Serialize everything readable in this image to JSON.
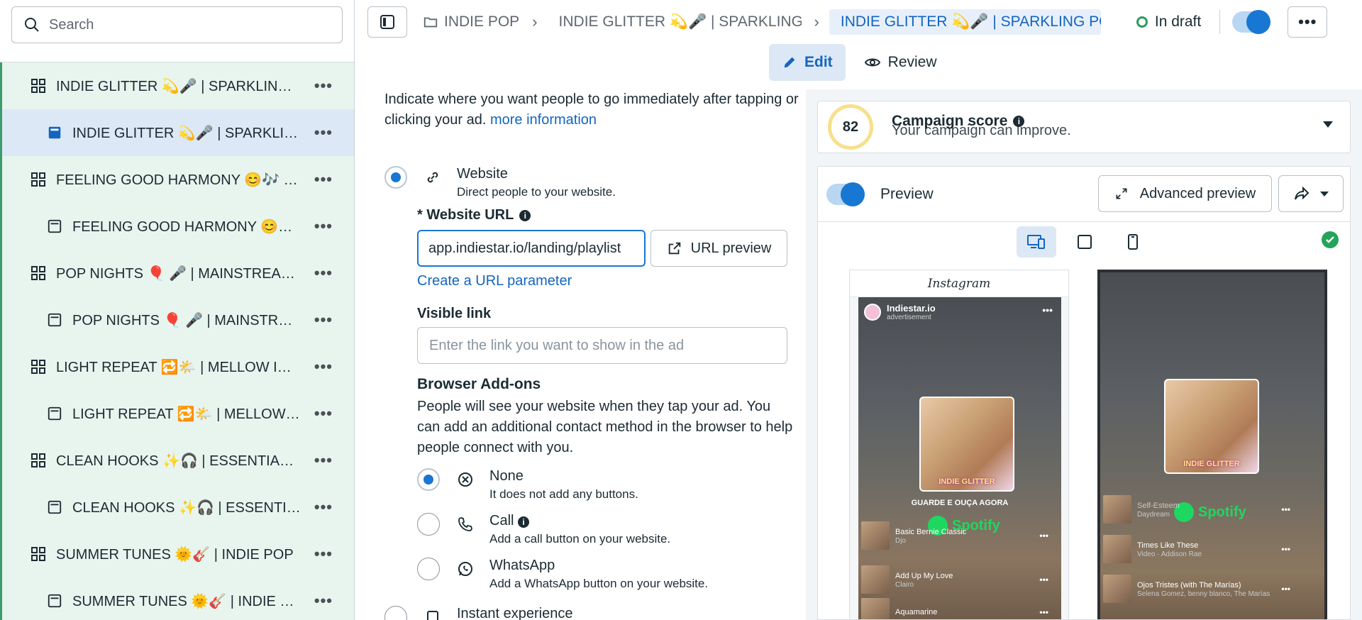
{
  "sidebar": {
    "search_placeholder": "Search",
    "items": [
      {
        "label": "INDIE GLITTER 💫🎤 | SPARKLING POP",
        "level": 0,
        "icon": "grid-icon",
        "selected": false
      },
      {
        "label": "INDIE GLITTER 💫🎤 | SPARKLING POP",
        "level": 1,
        "icon": "ad-filled-icon",
        "selected": true
      },
      {
        "label": "FEELING GOOD HARMONY 😊🎶 | FEEL GOOD",
        "level": 0,
        "icon": "grid-icon",
        "selected": false
      },
      {
        "label": "FEELING GOOD HARMONY 😊🎶 | FEEL GOOD",
        "level": 1,
        "icon": "ad-outline-icon",
        "selected": false
      },
      {
        "label": "POP NIGHTS 🎈 🎤 | MAINSTREAM POP",
        "level": 0,
        "icon": "grid-icon",
        "selected": false
      },
      {
        "label": "POP NIGHTS 🎈 🎤 | MAINSTREAM POP",
        "level": 1,
        "icon": "ad-outline-icon",
        "selected": false
      },
      {
        "label": "LIGHT REPEAT 🔁🌤️ | MELLOW INDIE",
        "level": 0,
        "icon": "grid-icon",
        "selected": false
      },
      {
        "label": "LIGHT REPEAT 🔁🌤️ | MELLOW INDIE",
        "level": 1,
        "icon": "ad-outline-icon",
        "selected": false
      },
      {
        "label": "CLEAN HOOKS ✨🎧 | ESSENTIAL POP",
        "level": 0,
        "icon": "grid-icon",
        "selected": false
      },
      {
        "label": "CLEAN HOOKS ✨🎧 | ESSENTIAL POP",
        "level": 1,
        "icon": "ad-outline-icon",
        "selected": false
      },
      {
        "label": "SUMMER TUNES 🌞🎸 | INDIE POP",
        "level": 0,
        "icon": "grid-icon",
        "selected": false
      },
      {
        "label": "SUMMER TUNES 🌞🎸 | INDIE POP",
        "level": 1,
        "icon": "ad-outline-icon",
        "selected": false
      }
    ],
    "more_glyph": "•••"
  },
  "topbar": {
    "crumb1": "INDIE POP",
    "crumb2": "INDIE GLITTER 💫🎤 | SPARKLING POP",
    "crumb3": "INDIE GLITTER 💫🎤 | SPARKLING POP",
    "status": "In draft",
    "more_glyph": "•••"
  },
  "modes": {
    "edit": "Edit",
    "review": "Review"
  },
  "form": {
    "lead": "Indicate where you want people to go immediately after tapping or clicking your ad.",
    "lead_link": "more information",
    "website_title": "Website",
    "website_desc": "Direct people to your website.",
    "url_label": "* Website URL",
    "url_value": "app.indiestar.io/landing/playlist",
    "url_preview": "URL preview",
    "url_param_link": "Create a URL parameter",
    "visible_link_label": "Visible link",
    "visible_link_placeholder": "Enter the link you want to show in the ad",
    "addons_title": "Browser Add-ons",
    "addons_desc": "People will see your website when they tap your ad. You can add an additional contact method in the browser to help people connect with you.",
    "none_title": "None",
    "none_desc": "It does not add any buttons.",
    "call_title": "Call",
    "call_desc": "Add a call button on your website.",
    "whatsapp_title": "WhatsApp",
    "whatsapp_desc": "Add a WhatsApp button on your website.",
    "instant_title": "Instant experience"
  },
  "right": {
    "score": "82",
    "score_title": "Campaign score",
    "score_sub": "Your campaign can improve.",
    "preview_label": "Preview",
    "advanced_preview": "Advanced preview",
    "ig_header": "Instagram",
    "account_name": "Indiestar.io",
    "account_sub": "advertisement",
    "cover_text": "INDIE GLITTER",
    "slogan": "GUARDE E OUÇA AGORA",
    "spotify": "Spotify",
    "p1_tracks": [
      {
        "title": "Basic Bernie Classic",
        "artist": "Djo"
      },
      {
        "title": "Add Up My Love",
        "artist": "Clairo"
      },
      {
        "title": "Aquamarine",
        "artist": ""
      }
    ],
    "p2_tracks": [
      {
        "title": "Self-Esteem",
        "artist": "Daydream"
      },
      {
        "title": "Times Like These",
        "artist": "Video · Addison Rae"
      },
      {
        "title": "Ojos Tristes (with The Marías)",
        "artist": "Selena Gomez, benny blanco, The Marías"
      }
    ]
  }
}
